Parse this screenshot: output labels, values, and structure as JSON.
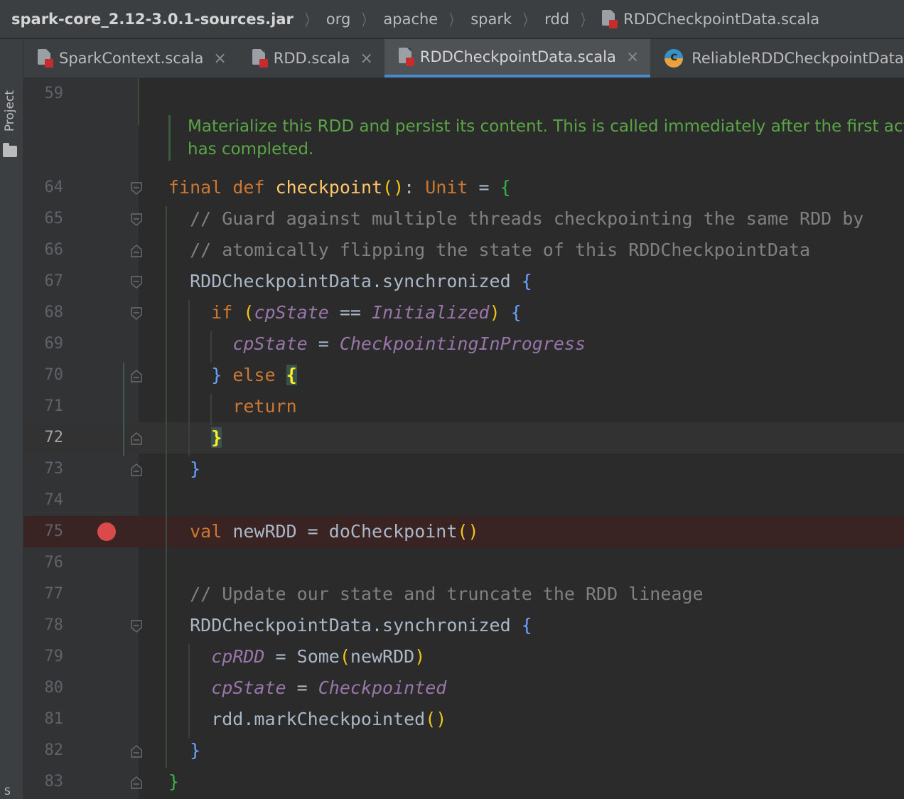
{
  "breadcrumb": {
    "root": "spark-core_2.12-3.0.1-sources.jar",
    "items": [
      "org",
      "apache",
      "spark",
      "rdd"
    ],
    "file": "RDDCheckpointData.scala"
  },
  "sidebar": {
    "project_label": "Project",
    "bottom_glyph": "S"
  },
  "tabs": [
    {
      "label": "SparkContext.scala",
      "icon": "scala-file-icon",
      "active": false
    },
    {
      "label": "RDD.scala",
      "icon": "scala-file-icon",
      "active": false
    },
    {
      "label": "RDDCheckpointData.scala",
      "icon": "scala-file-icon",
      "active": true
    },
    {
      "label": "ReliableRDDCheckpointData.scala",
      "icon": "scala-class-icon",
      "active": false
    }
  ],
  "tab_close_glyph": "×",
  "doc_comment": "Materialize this RDD and persist its content. This is called immediately after the first action invoked on this RDD has completed.",
  "doc_comment_line1": "Materialize this RDD and persist its content. This is called immediately after the first action i",
  "doc_comment_line2": "has completed.",
  "editor": {
    "first_line": "59",
    "current_line": "72",
    "breakpoint_line": "75",
    "lines": [
      {
        "n": "64",
        "tokens": [
          [
            "kw",
            "final "
          ],
          [
            "kw",
            "def "
          ],
          [
            "fn",
            "checkpoint"
          ],
          [
            "br1",
            "()"
          ],
          [
            "plain",
            ": "
          ],
          [
            "typ",
            "Unit"
          ],
          [
            "plain",
            " = "
          ],
          [
            "br3",
            "{"
          ]
        ]
      },
      {
        "n": "65",
        "tokens": [
          [
            "cmt",
            "  // Guard against multiple threads checkpointing the same RDD by"
          ]
        ]
      },
      {
        "n": "66",
        "tokens": [
          [
            "cmt",
            "  // atomically flipping the state of this RDDCheckpointData"
          ]
        ]
      },
      {
        "n": "67",
        "tokens": [
          [
            "plain",
            "  RDDCheckpointData.synchronized "
          ],
          [
            "br2",
            "{"
          ]
        ]
      },
      {
        "n": "68",
        "tokens": [
          [
            "plain",
            "    "
          ],
          [
            "kw",
            "if "
          ],
          [
            "br1",
            "("
          ],
          [
            "fld",
            "cpState"
          ],
          [
            "plain",
            " == "
          ],
          [
            "fld",
            "Initialized"
          ],
          [
            "br1",
            ")"
          ],
          [
            "plain",
            " "
          ],
          [
            "br2",
            "{"
          ]
        ]
      },
      {
        "n": "69",
        "tokens": [
          [
            "plain",
            "      "
          ],
          [
            "fld",
            "cpState"
          ],
          [
            "plain",
            " = "
          ],
          [
            "fld",
            "CheckpointingInProgress"
          ]
        ]
      },
      {
        "n": "70",
        "tokens": [
          [
            "plain",
            "    "
          ],
          [
            "br2",
            "}"
          ],
          [
            "plain",
            " "
          ],
          [
            "kw",
            "else "
          ],
          [
            "hlbrace",
            "{"
          ]
        ]
      },
      {
        "n": "71",
        "tokens": [
          [
            "plain",
            "      "
          ],
          [
            "kw",
            "return"
          ]
        ]
      },
      {
        "n": "72",
        "tokens": [
          [
            "plain",
            "    "
          ],
          [
            "hlbrace",
            "}"
          ]
        ]
      },
      {
        "n": "73",
        "tokens": [
          [
            "plain",
            "  "
          ],
          [
            "br2",
            "}"
          ]
        ]
      },
      {
        "n": "74",
        "tokens": []
      },
      {
        "n": "75",
        "tokens": [
          [
            "plain",
            "  "
          ],
          [
            "kw",
            "val "
          ],
          [
            "plain",
            "newRDD = doCheckpoint"
          ],
          [
            "br1",
            "()"
          ]
        ]
      },
      {
        "n": "76",
        "tokens": []
      },
      {
        "n": "77",
        "tokens": [
          [
            "cmt",
            "  // Update our state and truncate the RDD lineage"
          ]
        ]
      },
      {
        "n": "78",
        "tokens": [
          [
            "plain",
            "  RDDCheckpointData.synchronized "
          ],
          [
            "br2",
            "{"
          ]
        ]
      },
      {
        "n": "79",
        "tokens": [
          [
            "plain",
            "    "
          ],
          [
            "fld",
            "cpRDD"
          ],
          [
            "plain",
            " = Some"
          ],
          [
            "br1",
            "("
          ],
          [
            "plain",
            "newRDD"
          ],
          [
            "br1",
            ")"
          ]
        ]
      },
      {
        "n": "80",
        "tokens": [
          [
            "plain",
            "    "
          ],
          [
            "fld",
            "cpState"
          ],
          [
            "plain",
            " = "
          ],
          [
            "fld",
            "Checkpointed"
          ]
        ]
      },
      {
        "n": "81",
        "tokens": [
          [
            "plain",
            "    rdd.markCheckpointed"
          ],
          [
            "br1",
            "()"
          ]
        ]
      },
      {
        "n": "82",
        "tokens": [
          [
            "plain",
            "  "
          ],
          [
            "br2",
            "}"
          ]
        ]
      },
      {
        "n": "83",
        "tokens": [
          [
            "br3",
            "}"
          ]
        ]
      }
    ]
  },
  "colors": {
    "keyword": "#cc7832",
    "function": "#ffc66d",
    "comment": "#808080",
    "field": "#9876aa",
    "doc": "#5aa647",
    "breakpoint": "#db4a4a",
    "tab_underline": "#4a88c7"
  }
}
